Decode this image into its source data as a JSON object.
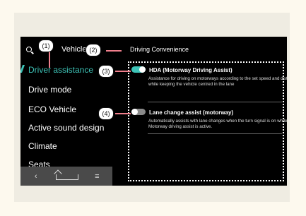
{
  "header": {
    "search_text": "Vehicle",
    "page_title": "Driving Convenience"
  },
  "sidebar": {
    "items": [
      {
        "label": "Driver assistance",
        "active": true
      },
      {
        "label": "Drive mode",
        "active": false
      },
      {
        "label": "ECO Vehicle",
        "active": false
      },
      {
        "label": "Active sound design",
        "active": false
      },
      {
        "label": "Climate",
        "active": false
      },
      {
        "label": "Seats",
        "active": false
      }
    ]
  },
  "bottom_nav": {
    "back": "‹",
    "menu": "≡"
  },
  "options": [
    {
      "title": "HDA (Motorway Driving Assist)",
      "description": "Assistance for driving on motorways according to the set speed and distance while keeping the vehicle centred in the lane",
      "enabled": true
    },
    {
      "title": "Lane change assist (motorway)",
      "description": "Automatically assists with lane changes when the turn signal is on while Motorway driving assist is active.",
      "enabled": false
    }
  ],
  "callouts": [
    "(1)",
    "(2)",
    "(3)",
    "(4)"
  ],
  "colors": {
    "accent": "#3ec4b8",
    "toggle_off": "#8a8a8a",
    "leader": "#f07f8c"
  }
}
